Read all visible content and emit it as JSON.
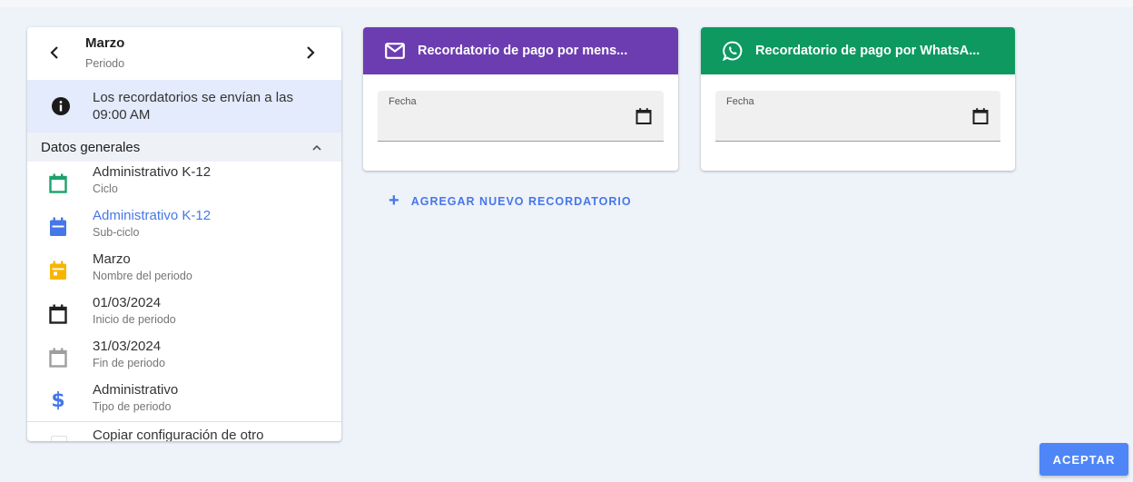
{
  "period_nav": {
    "title": "Marzo",
    "subtitle": "Periodo",
    "prev_icon": "chevron-left-icon",
    "next_icon": "chevron-right-icon"
  },
  "info_banner": {
    "icon": "info-icon",
    "text": "Los recordatorios se envían a las 09:00 AM"
  },
  "section": {
    "label": "Datos generales",
    "icon": "chevron-up-icon"
  },
  "general_items": [
    {
      "icon": "calendar-blank-icon",
      "color": "#1aa36b",
      "primary": "Administrativo K-12",
      "secondary": "Ciclo"
    },
    {
      "icon": "calendar-icon",
      "color": "#4677e8",
      "primary": "Administrativo K-12",
      "secondary": "Sub-ciclo"
    },
    {
      "icon": "calendar-today-icon",
      "color": "#f7b500",
      "primary": "Marzo",
      "secondary": "Nombre del periodo"
    },
    {
      "icon": "calendar-blank-icon",
      "color": "#212121",
      "primary": "01/03/2024",
      "secondary": "Inicio de periodo"
    },
    {
      "icon": "calendar-blank-icon",
      "color": "#9e9e9e",
      "primary": "31/03/2024",
      "secondary": "Fin de periodo"
    },
    {
      "icon": "dollar-icon",
      "color": "#4677e8",
      "primary": "Administrativo",
      "secondary": "Tipo de periodo"
    }
  ],
  "copy_config": {
    "label": "Copiar configuración de otro periodo",
    "checked": false
  },
  "reminders": [
    {
      "icon": "email-icon",
      "title": "Recordatorio de pago por mens...",
      "color": "#6c3db0",
      "field_label": "Fecha",
      "field_value": ""
    },
    {
      "icon": "whatsapp-icon",
      "title": "Recordatorio de pago por WhatsA...",
      "color": "#0d9960",
      "field_label": "Fecha",
      "field_value": ""
    }
  ],
  "add_reminder": {
    "label": "AGREGAR NUEVO RECORDATORIO",
    "icon": "plus-icon"
  },
  "accept_button": {
    "label": "ACEPTAR"
  }
}
